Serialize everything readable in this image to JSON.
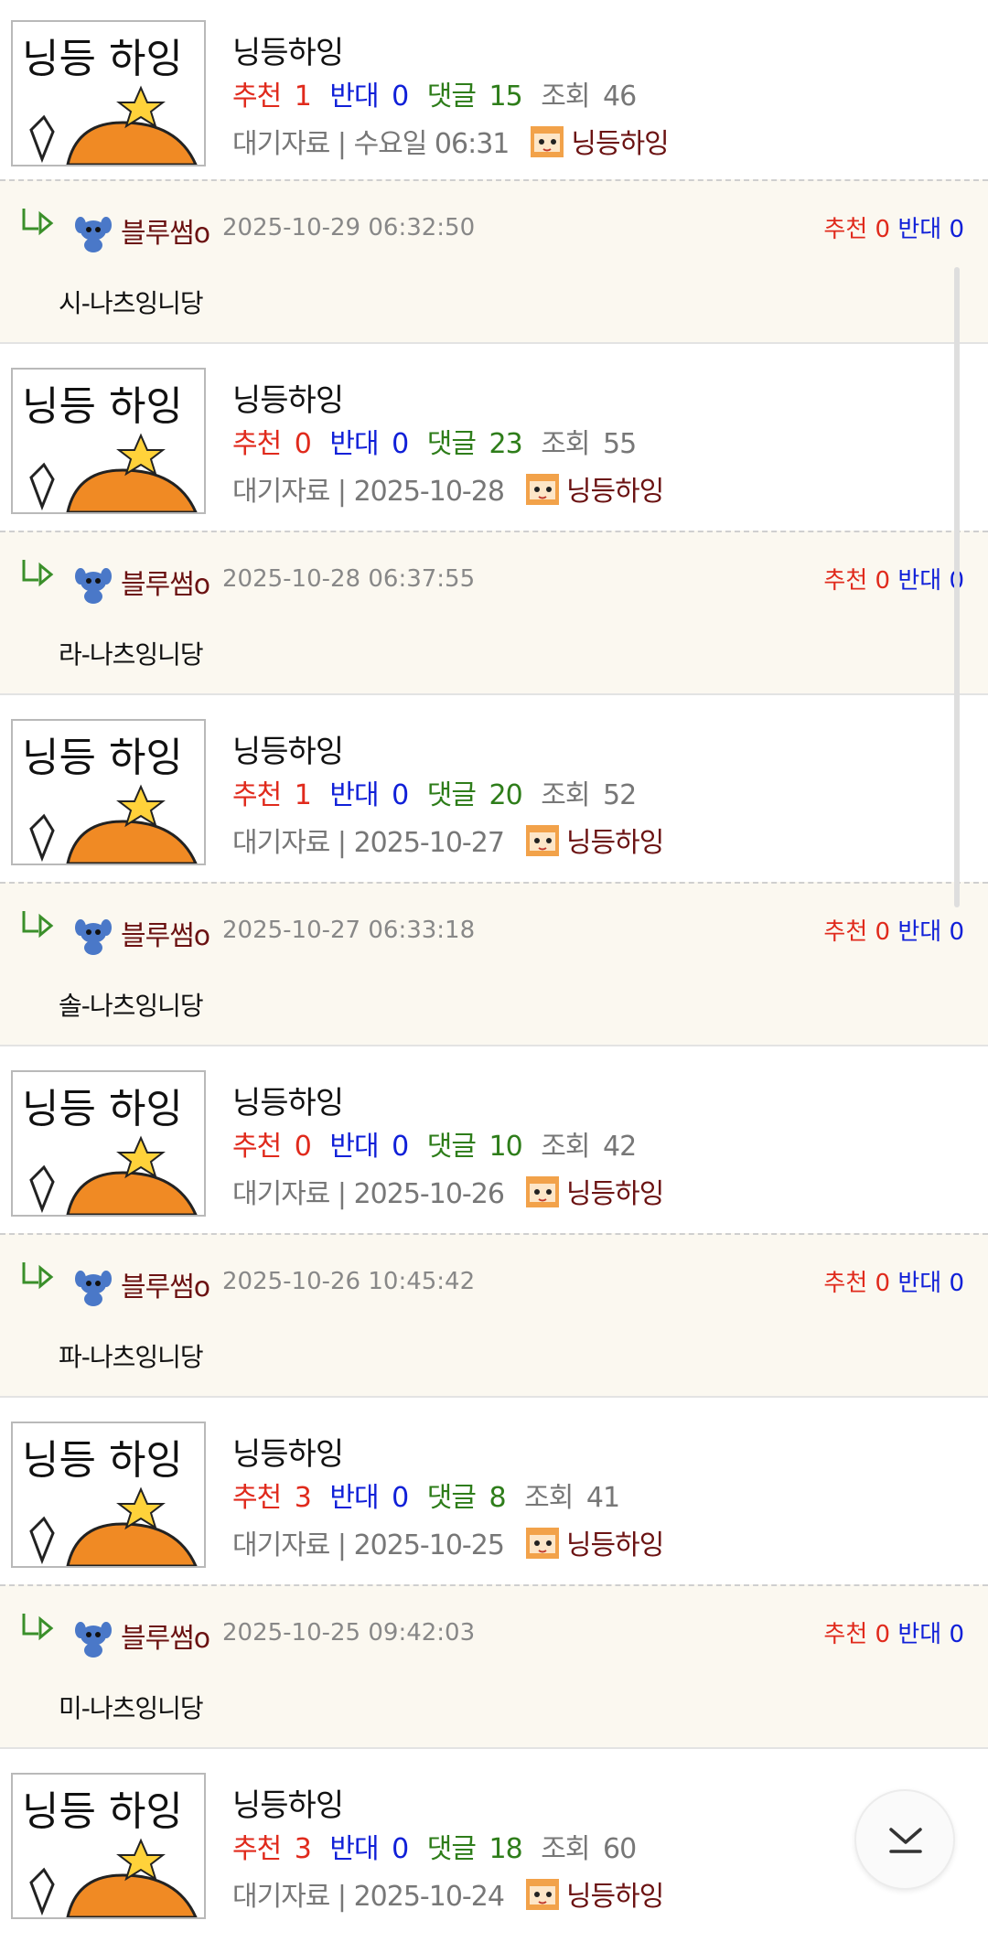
{
  "posts": [
    {
      "thumbnail_text": "닝등 하잉",
      "title": "닝등하잉",
      "rec_label": "추천",
      "rec": "1",
      "opp_label": "반대",
      "opp": "0",
      "cmt_label": "댓글",
      "cmt": "15",
      "view_label": "조회",
      "view": "46",
      "meta": "대기자료 | 수요일 06:31",
      "author": "닝등하잉",
      "reply": {
        "author": "블루썸o",
        "date": "2025-10-29 06:32:50",
        "rec_label": "추천",
        "rec": "0",
        "opp_label": "반대",
        "opp": "0",
        "text": "시-나츠잉니당"
      }
    },
    {
      "thumbnail_text": "닝등 하잉",
      "title": "닝등하잉",
      "rec_label": "추천",
      "rec": "0",
      "opp_label": "반대",
      "opp": "0",
      "cmt_label": "댓글",
      "cmt": "23",
      "view_label": "조회",
      "view": "55",
      "meta": "대기자료 | 2025-10-28",
      "author": "닝등하잉",
      "reply": {
        "author": "블루썸o",
        "date": "2025-10-28 06:37:55",
        "rec_label": "추천",
        "rec": "0",
        "opp_label": "반대",
        "opp": "0",
        "text": "라-나츠잉니당"
      }
    },
    {
      "thumbnail_text": "닝등 하잉",
      "title": "닝등하잉",
      "rec_label": "추천",
      "rec": "1",
      "opp_label": "반대",
      "opp": "0",
      "cmt_label": "댓글",
      "cmt": "20",
      "view_label": "조회",
      "view": "52",
      "meta": "대기자료 | 2025-10-27",
      "author": "닝등하잉",
      "reply": {
        "author": "블루썸o",
        "date": "2025-10-27 06:33:18",
        "rec_label": "추천",
        "rec": "0",
        "opp_label": "반대",
        "opp": "0",
        "text": "솔-나츠잉니당"
      }
    },
    {
      "thumbnail_text": "닝등 하잉",
      "title": "닝등하잉",
      "rec_label": "추천",
      "rec": "0",
      "opp_label": "반대",
      "opp": "0",
      "cmt_label": "댓글",
      "cmt": "10",
      "view_label": "조회",
      "view": "42",
      "meta": "대기자료 | 2025-10-26",
      "author": "닝등하잉",
      "reply": {
        "author": "블루썸o",
        "date": "2025-10-26 10:45:42",
        "rec_label": "추천",
        "rec": "0",
        "opp_label": "반대",
        "opp": "0",
        "text": "파-나츠잉니당"
      }
    },
    {
      "thumbnail_text": "닝등 하잉",
      "title": "닝등하잉",
      "rec_label": "추천",
      "rec": "3",
      "opp_label": "반대",
      "opp": "0",
      "cmt_label": "댓글",
      "cmt": "8",
      "view_label": "조회",
      "view": "41",
      "meta": "대기자료 | 2025-10-25",
      "author": "닝등하잉",
      "reply": {
        "author": "블루썸o",
        "date": "2025-10-25 09:42:03",
        "rec_label": "추천",
        "rec": "0",
        "opp_label": "반대",
        "opp": "0",
        "text": "미-나츠잉니당"
      }
    },
    {
      "thumbnail_text": "닝등 하잉",
      "title": "닝등하잉",
      "rec_label": "추천",
      "rec": "3",
      "opp_label": "반대",
      "opp": "0",
      "cmt_label": "댓글",
      "cmt": "18",
      "view_label": "조회",
      "view": "60",
      "meta": "대기자료 | 2025-10-24",
      "author": "닝등하잉"
    }
  ],
  "colors": {
    "recommend": "#e02a1c",
    "oppose": "#1020d8",
    "comment": "#2e7d1a",
    "author": "#6b1212",
    "reply_bg": "#fbf8f0"
  },
  "icons": {
    "reply_arrow": "reply-arrow-icon",
    "scroll_down": "chevron-down-icon"
  }
}
